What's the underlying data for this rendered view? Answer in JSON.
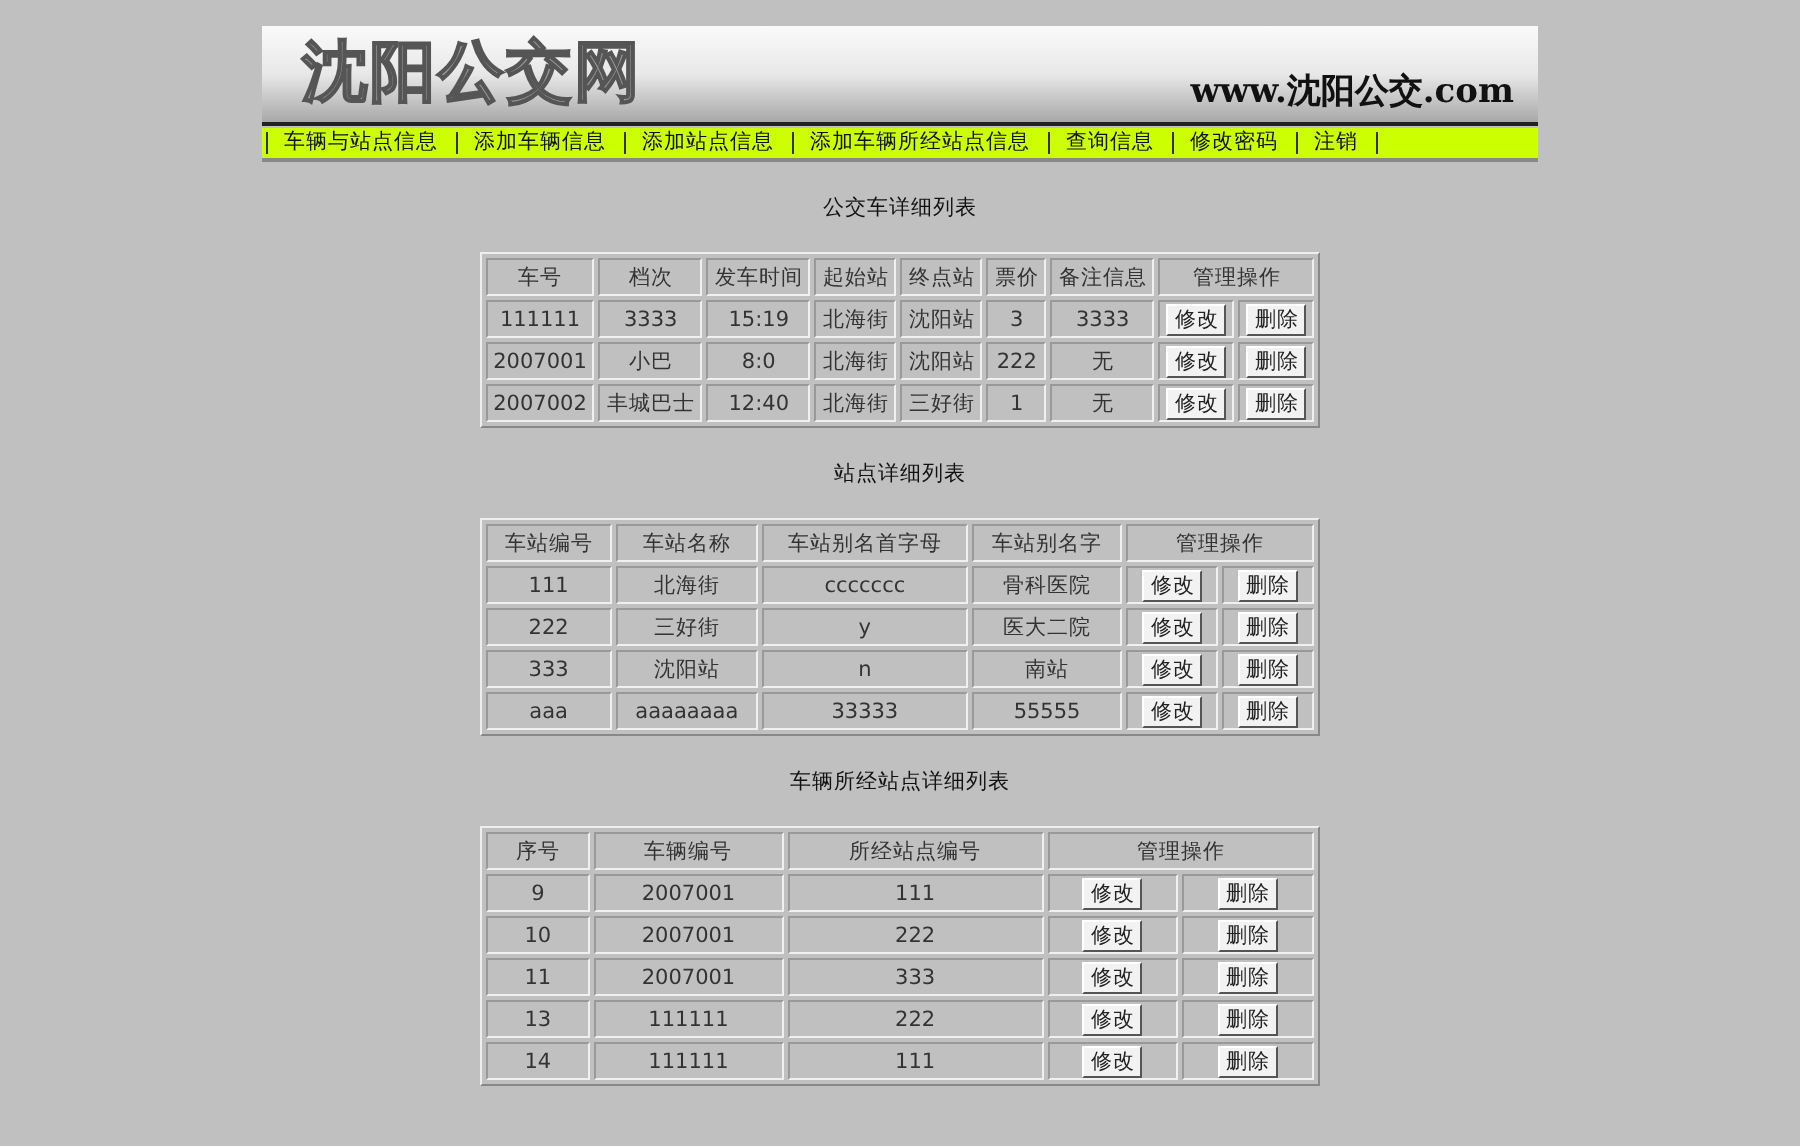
{
  "header": {
    "title": "沈阳公交网",
    "url": "www.沈阳公交.com"
  },
  "nav": [
    {
      "label": "车辆与站点信息"
    },
    {
      "label": "添加车辆信息"
    },
    {
      "label": "添加站点信息"
    },
    {
      "label": "添加车辆所经站点信息"
    },
    {
      "label": "查询信息"
    },
    {
      "label": "修改密码"
    },
    {
      "label": "注销"
    }
  ],
  "tables": [
    {
      "title": "公交车详细列表",
      "columns": [
        "车号",
        "档次",
        "发车时间",
        "起始站",
        "终点站",
        "票价",
        "备注信息",
        "管理操作"
      ],
      "rows": [
        {
          "cells": [
            "111111",
            "3333",
            "15:19",
            "北海街",
            "沈阳站",
            "3",
            "3333"
          ],
          "actions": [
            "修改",
            "删除"
          ]
        },
        {
          "cells": [
            "2007001",
            "小巴",
            "8:0",
            "北海街",
            "沈阳站",
            "222",
            "无"
          ],
          "actions": [
            "修改",
            "删除"
          ]
        },
        {
          "cells": [
            "2007002",
            "丰城巴士",
            "12:40",
            "北海街",
            "三好街",
            "1",
            "无"
          ],
          "actions": [
            "修改",
            "删除"
          ]
        }
      ]
    },
    {
      "title": "站点详细列表",
      "columns": [
        "车站编号",
        "车站名称",
        "车站别名首字母",
        "车站别名字",
        "管理操作"
      ],
      "rows": [
        {
          "cells": [
            "111",
            "北海街",
            "ccccccc",
            "骨科医院"
          ],
          "actions": [
            "修改",
            "删除"
          ]
        },
        {
          "cells": [
            "222",
            "三好街",
            "y",
            "医大二院"
          ],
          "actions": [
            "修改",
            "删除"
          ]
        },
        {
          "cells": [
            "333",
            "沈阳站",
            "n",
            "南站"
          ],
          "actions": [
            "修改",
            "删除"
          ]
        },
        {
          "cells": [
            "aaa",
            "aaaaaaaa",
            "33333",
            "55555"
          ],
          "actions": [
            "修改",
            "删除"
          ]
        }
      ]
    },
    {
      "title": "车辆所经站点详细列表",
      "columns": [
        "序号",
        "车辆编号",
        "所经站点编号",
        "管理操作"
      ],
      "rows": [
        {
          "cells": [
            "9",
            "2007001",
            "111"
          ],
          "actions": [
            "修改",
            "删除"
          ]
        },
        {
          "cells": [
            "10",
            "2007001",
            "222"
          ],
          "actions": [
            "修改",
            "删除"
          ]
        },
        {
          "cells": [
            "11",
            "2007001",
            "333"
          ],
          "actions": [
            "修改",
            "删除"
          ]
        },
        {
          "cells": [
            "13",
            "111111",
            "222"
          ],
          "actions": [
            "修改",
            "删除"
          ]
        },
        {
          "cells": [
            "14",
            "111111",
            "111"
          ],
          "actions": [
            "修改",
            "删除"
          ]
        }
      ]
    }
  ]
}
